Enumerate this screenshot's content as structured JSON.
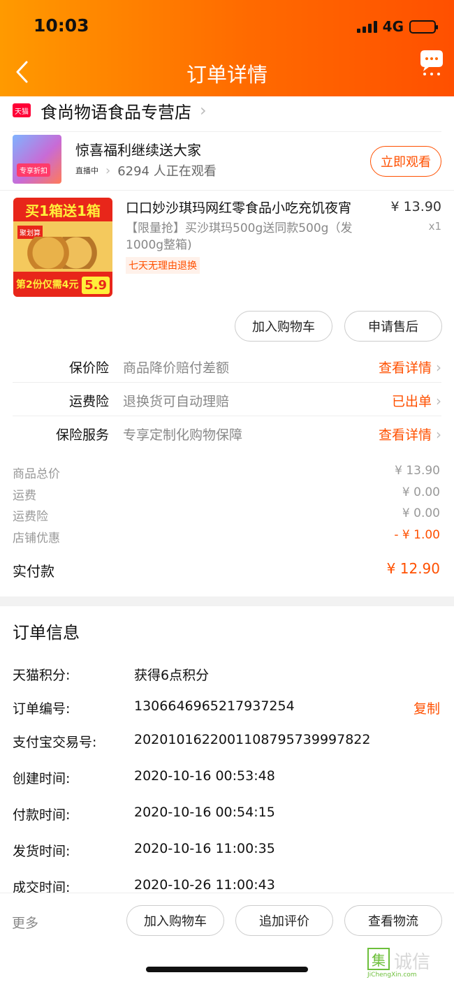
{
  "status_bar": {
    "time": "10:03",
    "network": "4G",
    "battery_level": 0.45
  },
  "nav": {
    "title": "订单详情"
  },
  "shop": {
    "badge": "天猫",
    "name": "食尚物语食品专营店"
  },
  "live": {
    "title": "惊喜福利继续送大家",
    "state": "直播中",
    "viewers": "6294 人正在观看",
    "watch_button": "立即观看",
    "thumb_tag": "专享折扣"
  },
  "product": {
    "name": "口口妙沙琪玛网红零食品小吃充饥夜宵",
    "desc": "【限量抢】买沙琪玛500g送同款500g（发1000g整箱)",
    "tag": "七天无理由退换",
    "price": "¥ 13.90",
    "qty": "x1",
    "image_text": {
      "header": "买1箱送1箱",
      "brand": "聚划算",
      "footer": "第2份仅需4元",
      "price": "5.9"
    }
  },
  "actions": {
    "add_cart": "加入购物车",
    "after_sale": "申请售后"
  },
  "insurance": [
    {
      "label": "保价险",
      "desc": "商品降价赔付差额",
      "action": "查看详情"
    },
    {
      "label": "运费险",
      "desc": "退换货可自动理赔",
      "action": "已出单"
    },
    {
      "label": "保险服务",
      "desc": "专享定制化购物保障",
      "action": "查看详情"
    }
  ],
  "summary": [
    {
      "label": "商品总价",
      "value": "¥ 13.90"
    },
    {
      "label": "运费",
      "value": "¥ 0.00"
    },
    {
      "label": "运费险",
      "value": "¥ 0.00"
    },
    {
      "label": "店铺优惠",
      "value": "- ¥ 1.00"
    }
  ],
  "total": {
    "label": "实付款",
    "value": "¥ 12.90"
  },
  "order_info": {
    "title": "订单信息",
    "rows": [
      {
        "label": "天猫积分:",
        "value": "获得6点积分"
      },
      {
        "label": "订单编号:",
        "value": "1306646965217937254",
        "action": "复制"
      },
      {
        "label": "支付宝交易号:",
        "value": "2020101622001108795739997822"
      },
      {
        "label": "创建时间:",
        "value": "2020-10-16 00:53:48"
      },
      {
        "label": "付款时间:",
        "value": "2020-10-16 00:54:15"
      },
      {
        "label": "发货时间:",
        "value": "2020-10-16 11:00:35"
      },
      {
        "label": "成交时间:",
        "value": "2020-10-26 11:00:43"
      }
    ]
  },
  "bottom_bar": {
    "more": "更多",
    "add_cart": "加入购物车",
    "review": "追加评价",
    "logistics": "查看物流"
  },
  "watermark": {
    "text": "集诚信",
    "url": "JiChengXin.com"
  },
  "colors": {
    "accent": "#ff5000",
    "header_start": "#ff9a00",
    "header_end": "#ff5000"
  }
}
